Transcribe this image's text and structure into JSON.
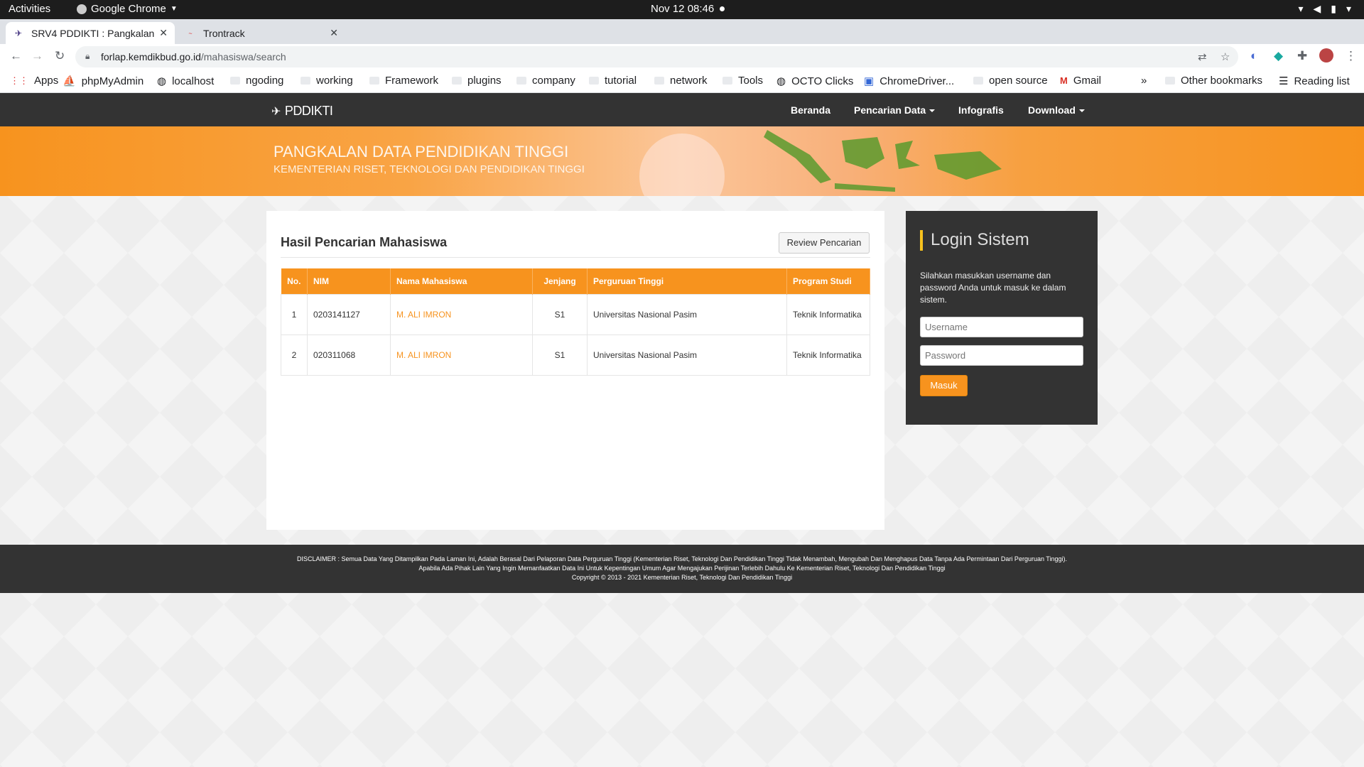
{
  "os_bar": {
    "activities": "Activities",
    "app_name": "Google Chrome",
    "clock": "Nov 12  08:46"
  },
  "browser": {
    "tabs": [
      {
        "title": "SRV4 PDDIKTI : Pangkalan",
        "active": true
      },
      {
        "title": "Trontrack",
        "active": false
      }
    ],
    "url_host": "forlap.kemdikbud.go.id",
    "url_path": "/mahasiswa/search",
    "bookmarks": [
      "Apps",
      "phpMyAdmin",
      "localhost",
      "ngoding",
      "working",
      "Framework",
      "plugins",
      "company",
      "tutorial",
      "network",
      "Tools",
      "OCTO Clicks",
      "ChromeDriver...",
      "open source",
      "Gmail"
    ],
    "bookmarks_overflow": "»",
    "other_bookmarks": "Other bookmarks",
    "reading_list": "Reading list"
  },
  "site": {
    "brand": "PDDIKTI",
    "nav": {
      "beranda": "Beranda",
      "pencarian": "Pencarian Data",
      "infografis": "Infografis",
      "download": "Download"
    },
    "banner_title": "PANGKALAN DATA PENDIDIKAN TINGGI",
    "banner_subtitle": "KEMENTERIAN RISET, TEKNOLOGI DAN PENDIDIKAN TINGGI",
    "accent_color": "#f7931e"
  },
  "results": {
    "title": "Hasil Pencarian Mahasiswa",
    "review_button": "Review Pencarian",
    "columns": [
      "No.",
      "NIM",
      "Nama Mahasiswa",
      "Jenjang",
      "Perguruan Tinggi",
      "Program Studi"
    ],
    "rows": [
      {
        "no": "1",
        "nim": "0203141127",
        "nama": "M. ALI IMRON",
        "jenjang": "S1",
        "pt": "Universitas Nasional Pasim",
        "prodi": "Teknik Informatika"
      },
      {
        "no": "2",
        "nim": "020311068",
        "nama": "M. ALI IMRON",
        "jenjang": "S1",
        "pt": "Universitas Nasional Pasim",
        "prodi": "Teknik Informatika"
      }
    ]
  },
  "login": {
    "title": "Login Sistem",
    "description": "Silahkan masukkan username dan password Anda untuk masuk ke dalam sistem.",
    "username_placeholder": "Username",
    "password_placeholder": "Password",
    "submit": "Masuk"
  },
  "footer": {
    "line1": "DISCLAIMER : Semua Data Yang Ditampilkan Pada Laman Ini, Adalah Berasal Dari Pelaporan Data Perguruan Tinggi (Kementerian Riset, Teknologi Dan Pendidikan Tinggi Tidak Menambah, Mengubah Dan Menghapus Data Tanpa Ada Permintaan Dari Perguruan Tinggi).",
    "line2": "Apabila Ada Pihak Lain Yang Ingin Memanfaatkan Data Ini Untuk Kepentingan Umum Agar Mengajukan Perijinan Terlebih Dahulu Ke Kementerian Riset, Teknologi Dan Pendidikan Tinggi",
    "line3": "Copyright © 2013 - 2021 Kementerian Riset, Teknologi Dan Pendidikan Tinggi"
  }
}
